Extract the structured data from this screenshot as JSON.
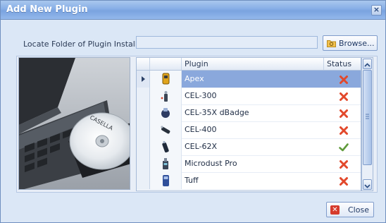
{
  "window": {
    "title": "Add New Plugin",
    "close_glyph": "×"
  },
  "locate": {
    "label": "Locate Folder of Plugin Installers",
    "path_value": ""
  },
  "browse": {
    "label": "Browse...",
    "icon": "folder-icon"
  },
  "grid": {
    "columns": {
      "plugin": "Plugin",
      "status": "Status"
    },
    "rows": [
      {
        "name": "Apex",
        "icon": "apex-pump-icon",
        "status": "not-installed",
        "selected": true
      },
      {
        "name": "CEL-300",
        "icon": "cel-300-meter-icon",
        "status": "not-installed",
        "selected": false
      },
      {
        "name": "CEL-35X dBadge",
        "icon": "dbadge-icon",
        "status": "not-installed",
        "selected": false
      },
      {
        "name": "CEL-400",
        "icon": "cel-400-meter-icon",
        "status": "not-installed",
        "selected": false
      },
      {
        "name": "CEL-62X",
        "icon": "cel-62x-meter-icon",
        "status": "installed",
        "selected": false
      },
      {
        "name": "Microdust Pro",
        "icon": "microdust-icon",
        "status": "not-installed",
        "selected": false
      },
      {
        "name": "Tuff",
        "icon": "tuff-pump-icon",
        "status": "not-installed",
        "selected": false
      }
    ]
  },
  "photo": {
    "disc_brand": "CASELLA"
  },
  "colors": {
    "not_installed": "#e2482b",
    "installed": "#5f9a3a",
    "selection": "#8aa8dc"
  },
  "close": {
    "label": "Close",
    "icon": "close-icon"
  }
}
